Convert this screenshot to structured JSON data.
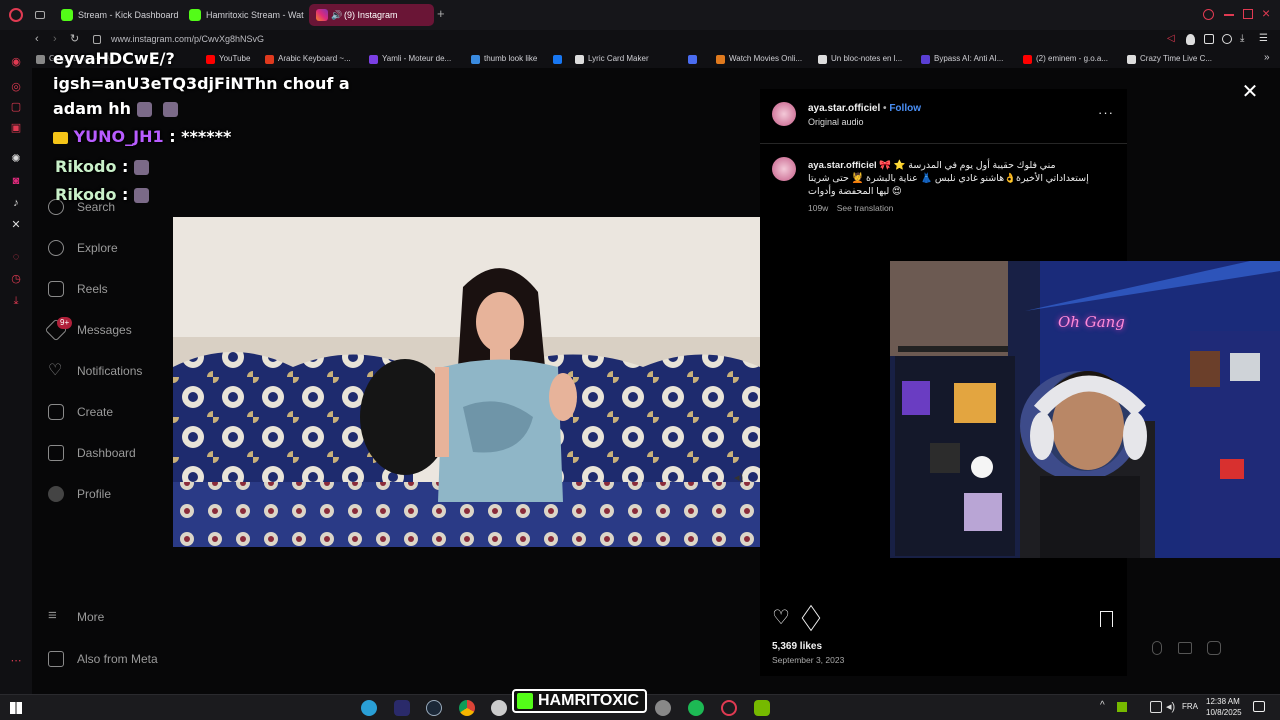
{
  "browser": {
    "tabs": [
      {
        "label": "Stream - Kick Dashboard",
        "color": "#53fc18"
      },
      {
        "label": "Hamritoxic Stream - Watc",
        "color": "#53fc18"
      },
      {
        "label": "(9) Instagram",
        "color": "#e1306c"
      }
    ],
    "url": "www.instagram.com/p/CwvXg8hNSvG",
    "bookmarks": [
      {
        "label": "Gen... Emoji — Al...",
        "color": "#888"
      },
      {
        "label": "YouTube",
        "color": "#ff0000"
      },
      {
        "label": "Arabic Keyboard ~...",
        "color": "#e03a1e"
      },
      {
        "label": "Yamli - Moteur de...",
        "color": "#7b3fe4"
      },
      {
        "label": "thumb look like",
        "color": "#3a8be0"
      },
      {
        "label": "",
        "color": "#1877f2"
      },
      {
        "label": "Lyric Card Maker",
        "color": "#ddd"
      },
      {
        "label": "",
        "color": "#4a6cf0"
      },
      {
        "label": "Watch Movies Onli...",
        "color": "#e07a1e"
      },
      {
        "label": "Un bloc-notes en l...",
        "color": "#ddd"
      },
      {
        "label": "Bypass AI: Anti AI...",
        "color": "#5a3fd4"
      },
      {
        "label": "(2) eminem - g.o.a...",
        "color": "#ff0000"
      },
      {
        "label": "Crazy Time Live C...",
        "color": "#ddd"
      }
    ]
  },
  "chat": {
    "line1": "eyvaHDCwE/?",
    "line2": "igsh=anU3eTQ3djFiNThn chouf a",
    "line3": "adam hh",
    "user1": "YUNO_JH1",
    "msg1": ": ******",
    "user2": "Rikodo",
    "msg2": ":",
    "user3": "Rikodo",
    "msg3": ":"
  },
  "instagram": {
    "nav": [
      "Search",
      "Explore",
      "Reels",
      "Messages",
      "Notifications",
      "Create",
      "Dashboard",
      "Profile"
    ],
    "nav_bottom": [
      "More",
      "Also from Meta"
    ],
    "messages_badge": "9+",
    "post": {
      "username": "aya.star.officiel",
      "follow": "Follow",
      "audio": "Original audio",
      "caption_user": "aya.star.officiel",
      "caption_line1": "مني فلوك حقيبة أول يوم في المدرسة ⭐ 🎀",
      "caption_line2": "إستعداداتي الأخيرة👌هاشنو غادي نلبس 👗 عناية بالبشرة 💆 حتى شريتا",
      "caption_line3": "😍 ليها المحفضة وأدوات",
      "age": "109w",
      "see_translation": "See translation",
      "likes": "5,369 likes",
      "date": "September 3, 2023"
    }
  },
  "overlay": {
    "streamer_logo": "HAMRITOXIC",
    "neon_sign": "Oh Gang"
  },
  "taskbar": {
    "lang": "FRA",
    "time": "12:38 AM",
    "date": "10/8/2025"
  }
}
